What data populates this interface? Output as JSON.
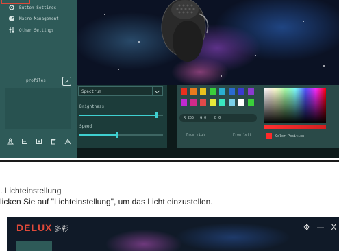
{
  "top_screenshot": {
    "sidebar": {
      "items": [
        {
          "icon": "gear-icon",
          "label": "Button Settings"
        },
        {
          "icon": "gauge-icon",
          "label": "Macro Management"
        },
        {
          "icon": "sliders-icon",
          "label": "Other Settings"
        }
      ],
      "profiles_label": "profiles",
      "bottom_icons": [
        "import-icon",
        "export-icon",
        "reset-icon",
        "delete-icon",
        "share-icon"
      ]
    },
    "lighting": {
      "mode_selected": "Spectrum",
      "brightness_label": "Brightness",
      "brightness_value": 0.92,
      "speed_label": "Speed",
      "speed_value": 0.45,
      "swatches_row1": [
        "#e8301e",
        "#e87a1e",
        "#e8c21e",
        "#3ad03a",
        "#2ab0d0",
        "#2a6ad0",
        "#3a3ad0",
        "#8a3ad0"
      ],
      "swatches_row2": [
        "#c02ad0",
        "#d02a8a",
        "#e04a4a",
        "#e8e83a",
        "#3ae8c0",
        "#7ad0e8",
        "#ffffff",
        "#3ad03a"
      ],
      "rgb_text": "R 255   G 0    B 0",
      "from_right_label": "From righ",
      "from_left_label": "From left",
      "color_position_label": "Color Position",
      "current_color": "#ff2a2a"
    }
  },
  "captions": {
    "line1": ". Lichteinstellung",
    "line2": "licken Sie auf \"Lichteinstellung\", um das Licht einzustellen."
  },
  "bottom_screenshot": {
    "logo_text": "DELUX",
    "logo_cn": "多彩",
    "controls": {
      "settings": "⚙",
      "minimize": "—",
      "close": "X"
    }
  },
  "colors": {
    "accent": "#3fd0d0",
    "sidebar": "#2e5a58",
    "brand_red": "#e04a3a"
  }
}
